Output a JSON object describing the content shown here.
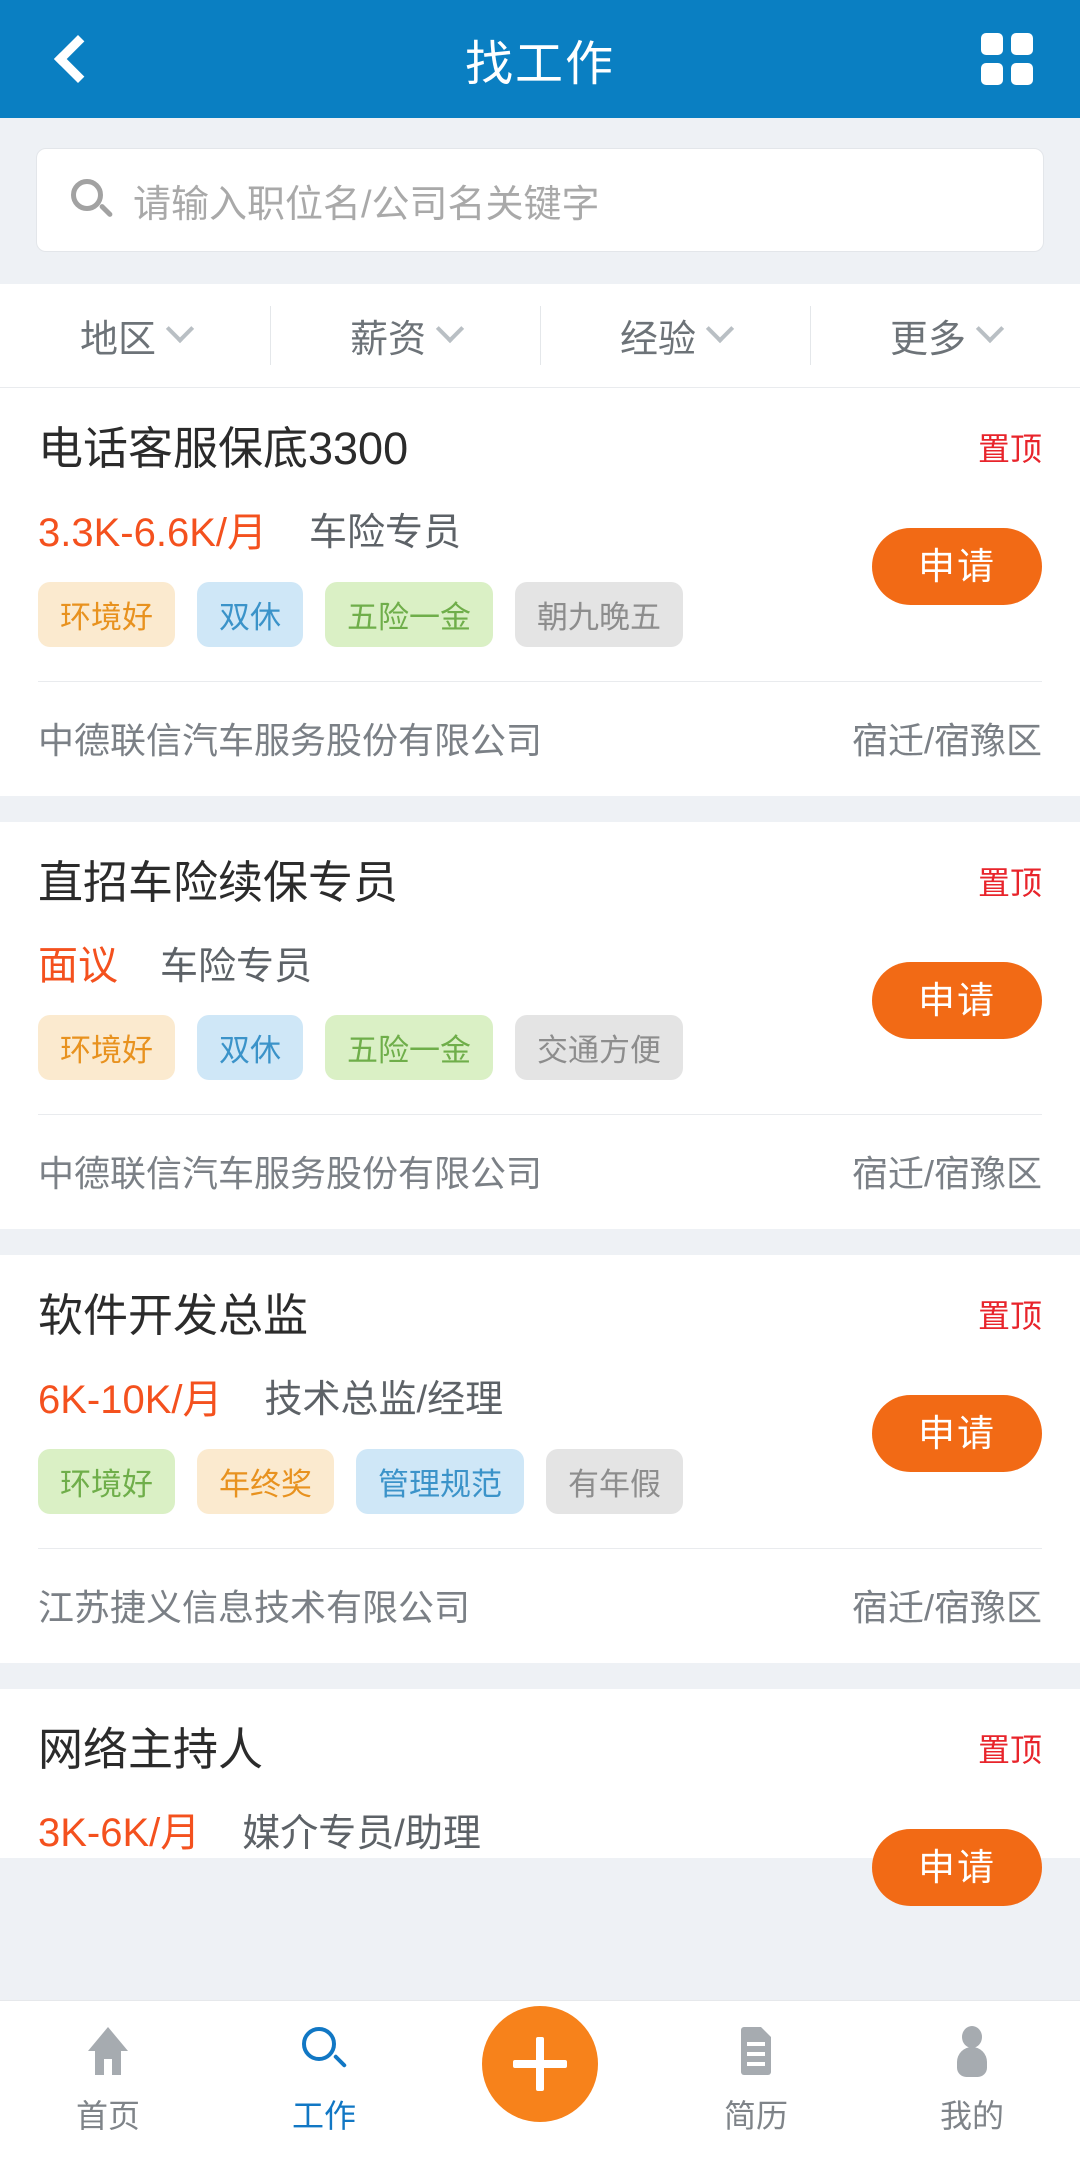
{
  "header": {
    "title": "找工作",
    "back_icon": "back-chevron-icon",
    "grid_icon": "grid-menu-icon"
  },
  "search": {
    "placeholder": "请输入职位名/公司名关键字",
    "icon": "search-icon"
  },
  "filters": [
    {
      "label": "地区",
      "icon": "chevron-down-icon"
    },
    {
      "label": "薪资",
      "icon": "chevron-down-icon"
    },
    {
      "label": "经验",
      "icon": "chevron-down-icon"
    },
    {
      "label": "更多",
      "icon": "chevron-down-icon"
    }
  ],
  "apply_label": "申请",
  "top_badge_label": "置顶",
  "jobs": [
    {
      "title": "电话客服保底3300",
      "badge": "置顶",
      "salary": "3.3K-6.6K/月",
      "category": "车险专员",
      "tags": [
        "环境好",
        "双休",
        "五险一金",
        "朝九晚五"
      ],
      "tag_styles": [
        "orange",
        "blue",
        "green",
        "gray"
      ],
      "company": "中德联信汽车服务股份有限公司",
      "location": "宿迁/宿豫区",
      "apply": "申请"
    },
    {
      "title": "直招车险续保专员",
      "badge": "置顶",
      "salary": "面议",
      "category": "车险专员",
      "tags": [
        "环境好",
        "双休",
        "五险一金",
        "交通方便"
      ],
      "tag_styles": [
        "orange",
        "blue",
        "green",
        "gray"
      ],
      "company": "中德联信汽车服务股份有限公司",
      "location": "宿迁/宿豫区",
      "apply": "申请"
    },
    {
      "title": "软件开发总监",
      "badge": "置顶",
      "salary": "6K-10K/月",
      "category": "技术总监/经理",
      "tags": [
        "环境好",
        "年终奖",
        "管理规范",
        "有年假"
      ],
      "tag_styles": [
        "green",
        "orange",
        "blue",
        "gray"
      ],
      "company": "江苏捷义信息技术有限公司",
      "location": "宿迁/宿豫区",
      "apply": "申请"
    },
    {
      "title": "网络主持人",
      "badge": "置顶",
      "salary": "3K-6K/月",
      "category": "媒介专员/助理",
      "tags": [],
      "tag_styles": [],
      "company": "",
      "location": "",
      "apply": "申请"
    }
  ],
  "bottom_nav": [
    {
      "label": "首页",
      "icon": "home-icon",
      "active": false
    },
    {
      "label": "工作",
      "icon": "search-icon",
      "active": true
    },
    {
      "label": "简历",
      "icon": "document-icon",
      "active": false
    },
    {
      "label": "我的",
      "icon": "person-icon",
      "active": false
    }
  ],
  "fab": {
    "icon": "plus-icon"
  },
  "colors": {
    "header_blue": "#0a7fc2",
    "accent_orange": "#f26a15",
    "fab_orange": "#f7821b",
    "salary_red": "#f4511e",
    "badge_red": "#e8242b",
    "active_blue": "#1177c4",
    "page_bg": "#eef1f5"
  }
}
